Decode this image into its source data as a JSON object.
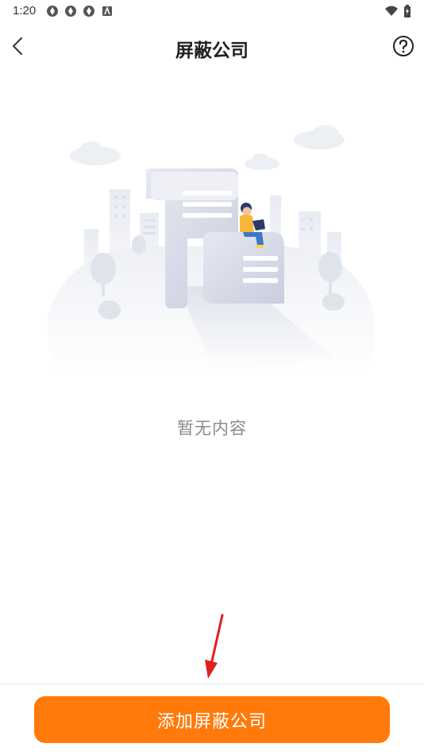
{
  "status_bar": {
    "time": "1:20"
  },
  "header": {
    "title": "屏蔽公司"
  },
  "empty_state": {
    "message": "暂无内容"
  },
  "footer": {
    "add_button_label": "添加屏蔽公司"
  },
  "colors": {
    "accent": "#ff7a0b",
    "annotation_arrow": "#e02020"
  },
  "icons": [
    "back-arrow-icon",
    "help-icon",
    "wifi-icon",
    "battery-icon",
    "notification-icon"
  ]
}
